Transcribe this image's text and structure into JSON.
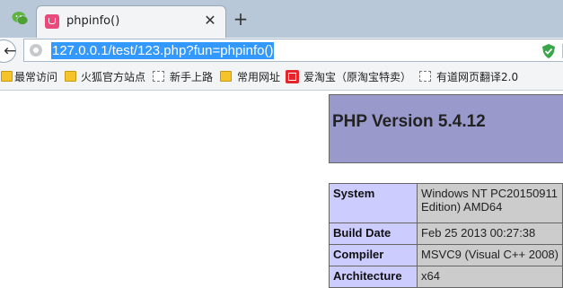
{
  "tabs": [
    {
      "title": "phpinfo()",
      "favicon": "php-page-icon",
      "active": true
    }
  ],
  "address_bar": {
    "url": "127.0.0.1/test/123.php?fun=phpinfo()"
  },
  "bookmarks": [
    {
      "label": "最常访问",
      "icon": "folder-icon"
    },
    {
      "label": "火狐官方站点",
      "icon": "folder-icon"
    },
    {
      "label": "新手上路",
      "icon": "page-icon"
    },
    {
      "label": "常用网址",
      "icon": "folder-icon"
    },
    {
      "label": "爱淘宝（原淘宝特卖）",
      "icon": "taobao-icon"
    },
    {
      "label": "有道网页翻译2.0",
      "icon": "page-icon"
    }
  ],
  "content": {
    "php_version_title": "PHP Version 5.4.12",
    "rows": [
      {
        "key": "System",
        "value_lines": [
          "Windows NT PC20150911",
          "Edition) AMD64"
        ]
      },
      {
        "key": "Build Date",
        "value_lines": [
          "Feb 25 2013 00:27:38"
        ]
      },
      {
        "key": "Compiler",
        "value_lines": [
          "MSVC9 (Visual C++ 2008)"
        ]
      },
      {
        "key": "Architecture",
        "value_lines": [
          "x64"
        ]
      }
    ]
  },
  "colors": {
    "header_bg": "#9999cc",
    "key_bg": "#ccccff",
    "value_bg": "#cccccc",
    "url_highlight": "#3399ff"
  }
}
